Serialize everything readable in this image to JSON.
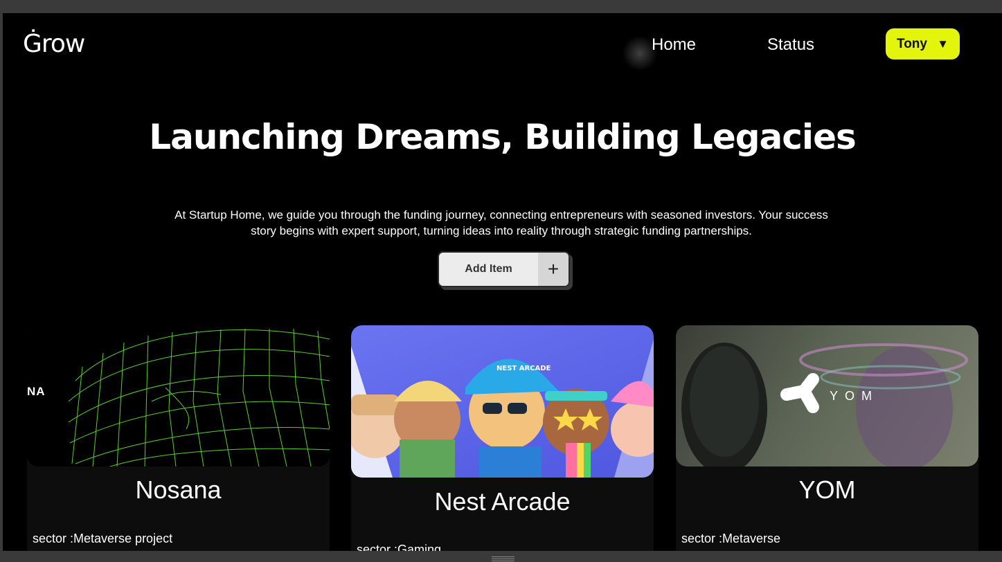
{
  "header": {
    "logo": "Ġrow",
    "nav": [
      {
        "label": "Home"
      },
      {
        "label": "Status"
      }
    ],
    "user": {
      "name": "Tony",
      "caret": "▼"
    }
  },
  "hero": {
    "title": "Launching Dreams, Building Legacies",
    "description": "At Startup Home, we guide you through the funding journey, connecting entrepreneurs with seasoned investors. Your success story begins with expert support, turning ideas into reality through strategic funding partnerships.",
    "add_button": {
      "label": "Add Item",
      "icon": "plus-icon",
      "icon_glyph": "+"
    }
  },
  "cards": [
    {
      "title": "Nosana",
      "sector": "sector :Metaverse project",
      "logo_text": "NA"
    },
    {
      "title": "Nest Arcade",
      "sector": "sector :Gaming",
      "logo_text": "NEST ARCADE"
    },
    {
      "title": "YOM",
      "sector": "sector :Metaverse",
      "logo_text": "YOM"
    }
  ],
  "colors": {
    "accent": "#e2f50a",
    "background": "#000000",
    "card_bg": "#0d0d0d",
    "wireframe": "#5cd12a",
    "nest_bg": "#5a63e8"
  }
}
